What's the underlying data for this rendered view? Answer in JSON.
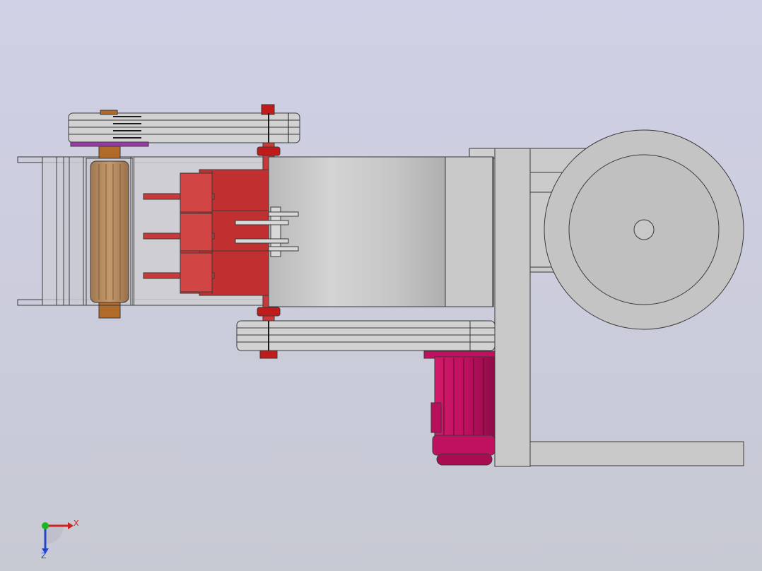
{
  "viewport": {
    "background_top": "#d0d0e6",
    "background_bottom": "#c7c9d3"
  },
  "model": {
    "colors": {
      "frame_gray": "#c9c9c9",
      "frame_light": "#d6d6d6",
      "hopper_gray": "#cfcfcf",
      "belt_gray": "#d2d2d2",
      "blade_red": "#c9393a",
      "blade_dark": "#a82a2b",
      "bolt_red": "#c01a1a",
      "motor_magenta": "#c01060",
      "roller_brown": "#b38a5c",
      "shaft_copper": "#b06a2a",
      "outline": "#3a3a3a",
      "purple_pulley": "#9a3aa8"
    }
  },
  "triad": {
    "x_label": "X",
    "z_label": "Z",
    "x_color": "#d21f1f",
    "y_color": "#18b81e",
    "z_color": "#2646c8"
  }
}
